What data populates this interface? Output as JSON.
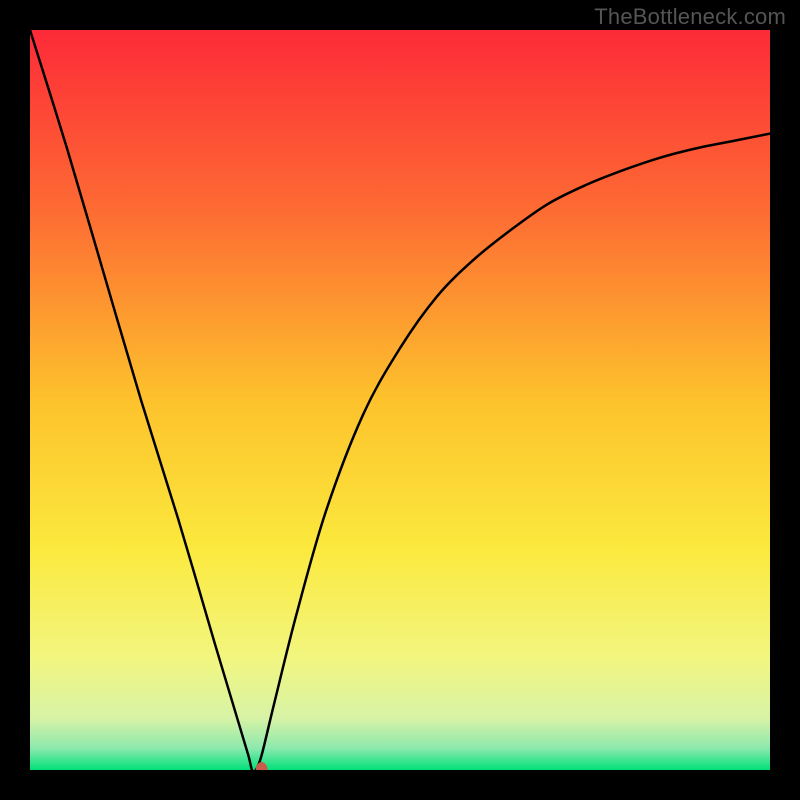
{
  "watermark": "TheBottleneck.com",
  "chart_data": {
    "type": "line",
    "title": "",
    "xlabel": "",
    "ylabel": "",
    "xlim": [
      0,
      100
    ],
    "ylim": [
      0,
      100
    ],
    "grid": false,
    "legend": false,
    "background_gradient": {
      "stops": [
        {
          "percent": 0,
          "color": "#fd2a38"
        },
        {
          "percent": 25,
          "color": "#fd6d33"
        },
        {
          "percent": 50,
          "color": "#fdc22c"
        },
        {
          "percent": 70,
          "color": "#fbe93d"
        },
        {
          "percent": 85,
          "color": "#f2f680"
        },
        {
          "percent": 93,
          "color": "#d7f3a6"
        },
        {
          "percent": 97,
          "color": "#8ee9ad"
        },
        {
          "percent": 100,
          "color": "#00e17a"
        }
      ]
    },
    "series": [
      {
        "name": "bottleneck-curve",
        "x": [
          0,
          5,
          10,
          15,
          20,
          25,
          28,
          29.5,
          30,
          30.5,
          31.3,
          33,
          36,
          40,
          45,
          50,
          55,
          60,
          65,
          70,
          75,
          80,
          85,
          90,
          95,
          100
        ],
        "y": [
          100,
          84,
          67,
          50,
          34,
          17,
          7,
          2,
          0,
          0,
          2,
          9,
          21,
          35,
          48,
          57,
          64,
          69,
          73,
          76.5,
          79,
          81,
          82.7,
          84,
          85,
          86
        ]
      }
    ],
    "marker": {
      "name": "optimal-point",
      "x": 31.3,
      "y": 0,
      "color": "#c95b4a",
      "rx": 6,
      "ry": 8
    }
  }
}
